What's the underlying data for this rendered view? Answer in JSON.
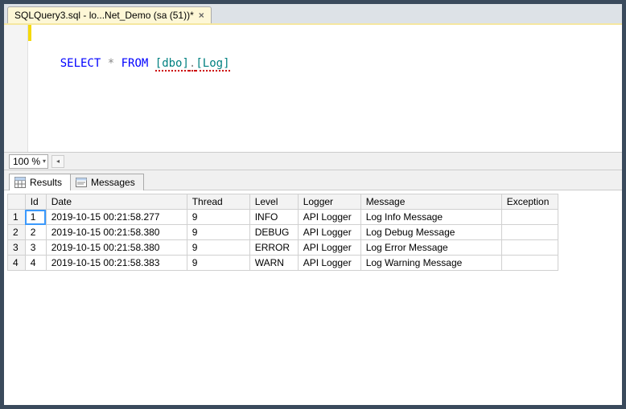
{
  "tab": {
    "title": "SQLQuery3.sql - lo...Net_Demo (sa (51))*",
    "close_glyph": "×"
  },
  "editor": {
    "sql_keyword_select": "SELECT",
    "sql_star": "*",
    "sql_keyword_from": "FROM",
    "sql_ident_schema": "[dbo]",
    "sql_dot": ".",
    "sql_ident_table": "[Log]"
  },
  "zoom": {
    "value": "100 %",
    "chev": "▾",
    "left_glyph": "◂"
  },
  "result_tabs": {
    "results": "Results",
    "messages": "Messages"
  },
  "grid": {
    "columns": [
      "Id",
      "Date",
      "Thread",
      "Level",
      "Logger",
      "Message",
      "Exception"
    ],
    "rows": [
      {
        "n": "1",
        "Id": "1",
        "Date": "2019-10-15 00:21:58.277",
        "Thread": "9",
        "Level": "INFO",
        "Logger": "API Logger",
        "Message": "Log Info Message",
        "Exception": ""
      },
      {
        "n": "2",
        "Id": "2",
        "Date": "2019-10-15 00:21:58.380",
        "Thread": "9",
        "Level": "DEBUG",
        "Logger": "API Logger",
        "Message": "Log Debug Message",
        "Exception": ""
      },
      {
        "n": "3",
        "Id": "3",
        "Date": "2019-10-15 00:21:58.380",
        "Thread": "9",
        "Level": "ERROR",
        "Logger": "API Logger",
        "Message": "Log Error Message",
        "Exception": ""
      },
      {
        "n": "4",
        "Id": "4",
        "Date": "2019-10-15 00:21:58.383",
        "Thread": "9",
        "Level": "WARN",
        "Logger": "API Logger",
        "Message": "Log Warning Message",
        "Exception": ""
      }
    ],
    "selected": {
      "row": 0,
      "col": "Id"
    }
  }
}
